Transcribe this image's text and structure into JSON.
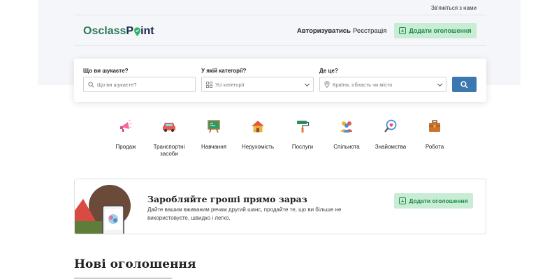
{
  "topbar": {
    "contact_link": "Зв'яжіться з нами"
  },
  "header": {
    "logo_text_1": "Osclass",
    "logo_text_2": "P",
    "logo_text_3": "int",
    "login_label": "Авторизуватись",
    "register_label": "Реєстрація",
    "post_ad_label": "Додати оголошення"
  },
  "search": {
    "what_label": "Що ви шукаєте?",
    "what_placeholder": "Що ви шукаєте?",
    "category_label": "У якій категорії?",
    "category_value": "Усі категорії",
    "where_label": "Де це?",
    "where_placeholder": "Країна, область чи місто"
  },
  "categories": [
    {
      "label": "Продаж",
      "icon": "megaphone-icon"
    },
    {
      "label": "Транспортні засоби",
      "icon": "car-icon"
    },
    {
      "label": "Навчання",
      "icon": "blackboard-icon"
    },
    {
      "label": "Нерухомість",
      "icon": "house-icon"
    },
    {
      "label": "Послуги",
      "icon": "paint-roller-icon"
    },
    {
      "label": "Спільнота",
      "icon": "people-icon"
    },
    {
      "label": "Знайомства",
      "icon": "heart-magnifier-icon"
    },
    {
      "label": "Робота",
      "icon": "briefcase-icon"
    }
  ],
  "promo": {
    "title": "Заробляйте гроші прямо зараз",
    "text": "Дайте вашим вживаним речам другий шанс, продайте те, що ви більше не використовуєте, швидко і легко.",
    "button_label": "Додати оголошення"
  },
  "listings": {
    "title": "Нові оголошення"
  },
  "colors": {
    "brand_green": "#2b7a5a",
    "accent_blue": "#3c78b0",
    "button_green_bg": "#c8ecd4",
    "button_green_text": "#1e8c4a"
  }
}
